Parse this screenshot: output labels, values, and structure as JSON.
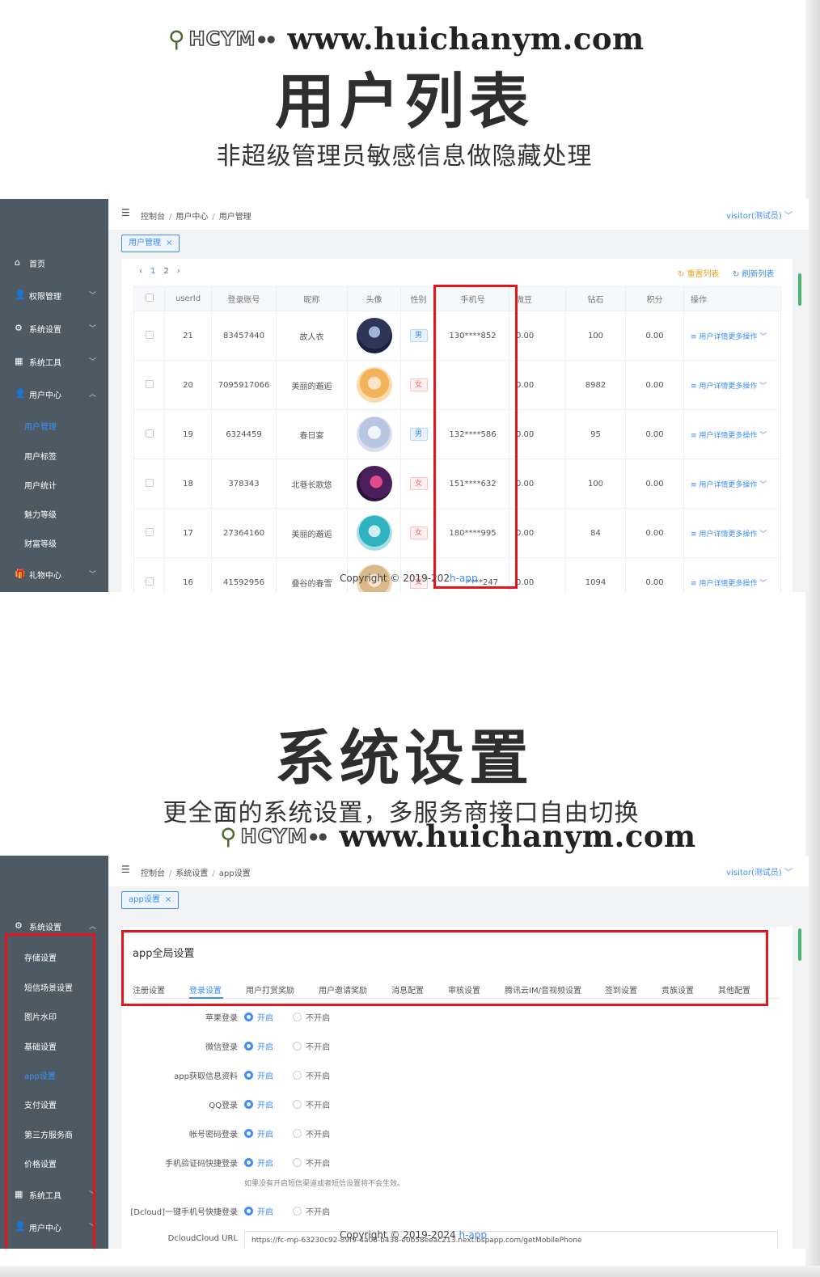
{
  "brand": {
    "logo_text": "HCYM",
    "url": "www.huichanym.com"
  },
  "section1": {
    "title": "用户列表",
    "subtitle": "非超级管理员敏感信息做隐藏处理"
  },
  "section2": {
    "title": "系统设置",
    "subtitle": "更全面的系统设置，多服务商接口自由切换"
  },
  "app1": {
    "sidebar": [
      {
        "icon": "⌂",
        "label": "首页",
        "arrow": ""
      },
      {
        "icon": "👤",
        "label": "权限管理",
        "arrow": "﹀"
      },
      {
        "icon": "⚙",
        "label": "系统设置",
        "arrow": "﹀"
      },
      {
        "icon": "▦",
        "label": "系统工具",
        "arrow": "﹀"
      },
      {
        "icon": "👤",
        "label": "用户中心",
        "arrow": "︿"
      },
      {
        "icon": "🎁",
        "label": "礼物中心",
        "arrow": "﹀"
      }
    ],
    "sub_items": [
      "用户管理",
      "用户标签",
      "用户统计",
      "魅力等级",
      "财富等级"
    ],
    "breadcrumb": [
      "控制台",
      "用户中心",
      "用户管理"
    ],
    "visitor": "visitor(测试员) ﹀",
    "tag": "用户管理",
    "pager": {
      "prev": "‹",
      "p1": "1",
      "p2": "2",
      "next": "›"
    },
    "reset_label": "↻ 重置列表",
    "refresh_label": "↻ 刷新列表",
    "columns": [
      "userId",
      "登录账号",
      "昵称",
      "头像",
      "性别",
      "手机号",
      "微豆",
      "钻石",
      "积分",
      "操作"
    ],
    "rows": [
      {
        "id": "21",
        "account": "83457440",
        "nick": "故人衣",
        "sex": "男",
        "phone": "130****852",
        "beans": "0.00",
        "diamond": "100",
        "points": "0.00"
      },
      {
        "id": "20",
        "account": "7095917066",
        "nick": "美丽的邂逅",
        "sex": "女",
        "phone": "",
        "beans": "0.00",
        "diamond": "8982",
        "points": "0.00"
      },
      {
        "id": "19",
        "account": "6324459",
        "nick": "春日宴",
        "sex": "男",
        "phone": "132****586",
        "beans": "0.00",
        "diamond": "95",
        "points": "0.00"
      },
      {
        "id": "18",
        "account": "378343",
        "nick": "北巷长歌悠",
        "sex": "女",
        "phone": "151****632",
        "beans": "0.00",
        "diamond": "100",
        "points": "0.00"
      },
      {
        "id": "17",
        "account": "27364160",
        "nick": "美丽的邂逅",
        "sex": "女",
        "phone": "180****995",
        "beans": "0.00",
        "diamond": "84",
        "points": "0.00"
      },
      {
        "id": "16",
        "account": "41592956",
        "nick": "叠谷的春雪",
        "sex": "女",
        "phone": "****247",
        "beans": "0.00",
        "diamond": "1094",
        "points": "0.00"
      }
    ],
    "op_detail": "≡ 用户详情",
    "op_more": "更多操作 ﹀",
    "copyright": {
      "text": "Copyright © 2019-202",
      "link": "h-app"
    }
  },
  "app2": {
    "sidebar_parent": {
      "icon": "⚙",
      "label": "系统设置",
      "arrow": "︿"
    },
    "sub_items": [
      "存储设置",
      "短信场景设置",
      "图片水印",
      "基础设置",
      "app设置",
      "支付设置",
      "第三方服务商",
      "价格设置"
    ],
    "sidebar_bottom": [
      {
        "icon": "▦",
        "label": "系统工具",
        "arrow": "﹀"
      },
      {
        "icon": "👤",
        "label": "用户中心",
        "arrow": "﹀"
      }
    ],
    "breadcrumb": [
      "控制台",
      "系统设置",
      "app设置"
    ],
    "visitor": "visitor(测试员) ﹀",
    "tag": "app设置",
    "card_title": "app全局设置",
    "tabs": [
      "注册设置",
      "登录设置",
      "用户打赏奖励",
      "用户邀请奖励",
      "消息配置",
      "审核设置",
      "腾讯云IM/音视频设置",
      "签到设置",
      "贵族设置",
      "其他配置"
    ],
    "fields": [
      "苹果登录",
      "微信登录",
      "app获取信息资料",
      "QQ登录",
      "帐号密码登录",
      "手机验证码快捷登录",
      "[Dcloud]一键手机号快捷登录",
      "DcloudCloud URL"
    ],
    "on_label": "开启",
    "off_label": "不开启",
    "hint": "如果没有开启短信渠道或者短信设置将不会生效。",
    "url_value": "https://fc-mp-63230c92-89f9-4a08-b438-e0b58eeac213.next.bspapp.com/getMobilePhone",
    "copyright": {
      "text": "Copyright © 2019-2024 ",
      "link": "h-app"
    }
  },
  "colors": {
    "accent": "#3d8df5",
    "highlight": "#e3161d",
    "sidebar": "#4d5a64"
  }
}
